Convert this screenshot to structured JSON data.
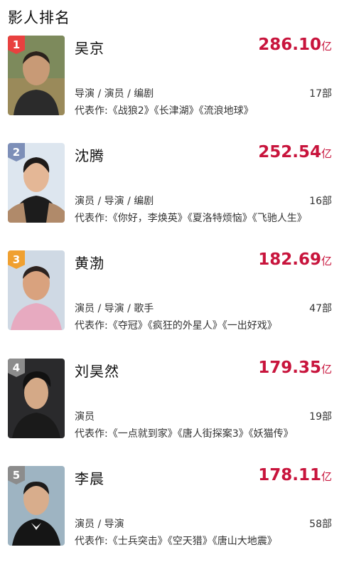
{
  "section_title": "影人排名",
  "box_unit": "亿",
  "people": [
    {
      "rank": "1",
      "name": "吴京",
      "box": "286.10",
      "roles": "导演 / 演员 / 编剧",
      "count": "17部",
      "works": "代表作:《战狼2》《长津湖》《流浪地球》",
      "badge_color": "#e8413f"
    },
    {
      "rank": "2",
      "name": "沈腾",
      "box": "252.54",
      "roles": "演员 / 导演 / 编剧",
      "count": "16部",
      "works": "代表作:《你好，李焕英》《夏洛特烦恼》《飞驰人生》",
      "badge_color": "#7d8fb8"
    },
    {
      "rank": "3",
      "name": "黄渤",
      "box": "182.69",
      "roles": "演员 / 导演 / 歌手",
      "count": "47部",
      "works": "代表作:《夺冠》《疯狂的外星人》《一出好戏》",
      "badge_color": "#f0a030"
    },
    {
      "rank": "4",
      "name": "刘昊然",
      "box": "179.35",
      "roles": "演员",
      "count": "19部",
      "works": "代表作:《一点就到家》《唐人街探案3》《妖猫传》",
      "badge_color": "#8c8c8c"
    },
    {
      "rank": "5",
      "name": "李晨",
      "box": "178.11",
      "roles": "演员 / 导演",
      "count": "58部",
      "works": "代表作:《士兵突击》《空天猎》《唐山大地震》",
      "badge_color": "#8c8c8c"
    }
  ]
}
